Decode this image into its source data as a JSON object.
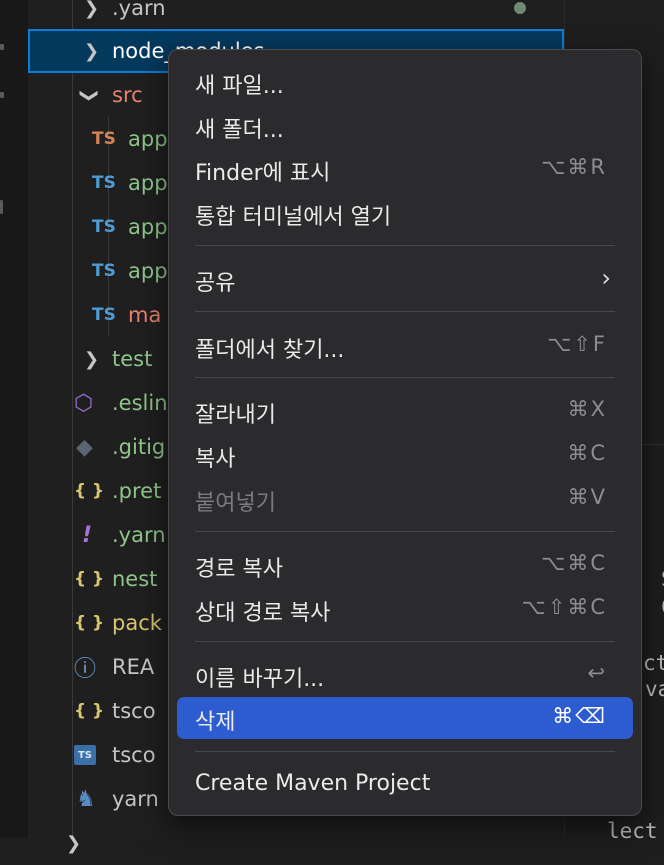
{
  "explorer": {
    "items": [
      {
        "label": ".yarn",
        "type": "folder",
        "color": "#c5c5c5"
      },
      {
        "label": "node_modules",
        "type": "folder",
        "color": "#ffffff"
      },
      {
        "label": "src",
        "type": "folder",
        "color": "#e8826e"
      },
      {
        "icon": "TS",
        "label": "app",
        "color": "#8fc58b",
        "icon_color": "#d48356"
      },
      {
        "icon": "TS",
        "label": "app",
        "color": "#8fc58b",
        "icon_color": "#4e9bd6"
      },
      {
        "icon": "TS",
        "label": "app",
        "color": "#8fc58b",
        "icon_color": "#4e9bd6"
      },
      {
        "icon": "TS",
        "label": "app",
        "color": "#8fc58b",
        "icon_color": "#4e9bd6"
      },
      {
        "icon": "TS",
        "label": "ma",
        "color": "#e8826e",
        "icon_color": "#4e9bd6"
      },
      {
        "label": "test",
        "type": "folder",
        "color": "#8fc58b"
      },
      {
        "label": ".eslin",
        "icon_name": "eslint-icon",
        "color": "#8fc58b"
      },
      {
        "label": ".gitig",
        "icon_name": "git-icon",
        "color": "#8fc58b"
      },
      {
        "icon": "{ }",
        "label": ".pret",
        "color": "#8fc58b"
      },
      {
        "icon": "!",
        "label": ".yarn",
        "color": "#8fc58b"
      },
      {
        "icon": "{ }",
        "label": "nest",
        "color": "#8fc58b"
      },
      {
        "icon": "{ }",
        "label": "pack",
        "color": "#d9c56e"
      },
      {
        "icon": "ⓘ",
        "label": "REA",
        "color": "#c5c5c5"
      },
      {
        "icon": "{ }",
        "label": "tsco",
        "color": "#c5c5c5"
      },
      {
        "icon": "TS",
        "label": "tsco",
        "color": "#c5c5c5"
      },
      {
        "label": "yarn",
        "icon_name": "yarn-icon",
        "color": "#c5c5c5"
      }
    ]
  },
  "editor": {
    "fragments": [
      "S",
      "C",
      "ctd",
      "va",
      "lect"
    ]
  },
  "context_menu": {
    "items": [
      {
        "label": "새 파일...",
        "shortcut": ""
      },
      {
        "label": "새 폴더...",
        "shortcut": ""
      },
      {
        "label": "Finder에 표시",
        "shortcut": "⌥⌘R"
      },
      {
        "label": "통합 터미널에서 열기",
        "shortcut": ""
      },
      {
        "label": "공유",
        "shortcut": "",
        "submenu": "›"
      },
      {
        "label": "폴더에서 찾기...",
        "shortcut": "⌥⇧F"
      },
      {
        "label": "잘라내기",
        "shortcut": "⌘X"
      },
      {
        "label": "복사",
        "shortcut": "⌘C"
      },
      {
        "label": "붙여넣기",
        "shortcut": "⌘V",
        "disabled": true
      },
      {
        "label": "경로 복사",
        "shortcut": "⌥⌘C"
      },
      {
        "label": "상대 경로 복사",
        "shortcut": "⌥⇧⌘C"
      },
      {
        "label": "이름 바꾸기...",
        "shortcut": "↩"
      },
      {
        "label": "삭제",
        "shortcut": "⌘⌫",
        "active": true
      },
      {
        "label": "Create Maven Project",
        "shortcut": ""
      }
    ]
  },
  "colors": {
    "menu_bg": "#2b2a2c",
    "highlight": "#2c5ccf",
    "selection": "#04395e"
  }
}
